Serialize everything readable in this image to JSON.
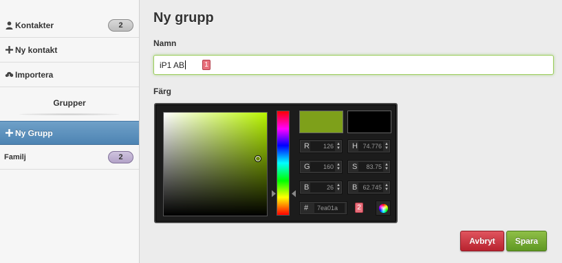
{
  "sidebar": {
    "items": [
      {
        "label": "Kontakter",
        "icon": "person-icon",
        "badge": "2"
      },
      {
        "label": "Ny kontakt",
        "icon": "plus-icon"
      },
      {
        "label": "Importera",
        "icon": "cloud-icon"
      }
    ],
    "groups_header": "Grupper",
    "new_group": {
      "label": "Ny Grupp",
      "icon": "plus-icon"
    },
    "groups": [
      {
        "label": "Familj",
        "badge": "2"
      }
    ]
  },
  "main": {
    "title": "Ny grupp",
    "name_label": "Namn",
    "name_value": "iP1 AB",
    "color_label": "Färg",
    "marker1": "1",
    "marker2": "2"
  },
  "color_picker": {
    "new_color": "#7ea01a",
    "current_color": "#000000",
    "fields": {
      "r_label": "R",
      "r_value": "126",
      "g_label": "G",
      "g_value": "160",
      "b_label": "B",
      "b_value": "26",
      "h_label": "H",
      "h_value": "74.776",
      "s_label": "S",
      "s_value": "83.75",
      "bri_label": "B",
      "bri_value": "62.745",
      "hex_label": "#",
      "hex_value": "7ea01a"
    }
  },
  "buttons": {
    "cancel": "Avbryt",
    "save": "Spara"
  },
  "colors": {
    "active_item": "#5a8fbf",
    "cancel": "#c8303c",
    "save": "#72a830",
    "input_focus": "#9ccd5c"
  }
}
